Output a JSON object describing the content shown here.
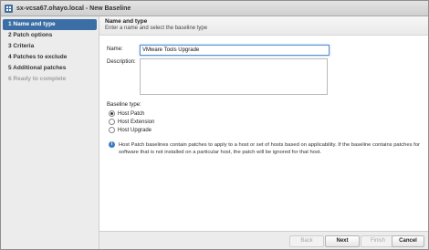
{
  "window": {
    "title": "sx-vcsa67.ohayo.local - New Baseline"
  },
  "sidebar": {
    "steps": [
      {
        "label": "1  Name and type"
      },
      {
        "label": "2  Patch options"
      },
      {
        "label": "3  Criteria"
      },
      {
        "label": "4  Patches to exclude"
      },
      {
        "label": "5  Additional patches"
      },
      {
        "label": "6  Ready to complete"
      }
    ]
  },
  "header": {
    "title": "Name and type",
    "subtitle": "Enter a name and select the baseline type"
  },
  "form": {
    "name_label": "Name:",
    "name_value": "VMware Tools Upgrade",
    "description_label": "Description:",
    "description_value": "",
    "baseline_type_label": "Baseline type:",
    "options": [
      {
        "label": "Host Patch",
        "checked": true
      },
      {
        "label": "Host Extension",
        "checked": false
      },
      {
        "label": "Host Upgrade",
        "checked": false
      }
    ]
  },
  "info": {
    "icon": "info-icon",
    "text": "Host Patch baselines contain patches to apply to a host or set of hosts based on applicability. If the baseline contains patches for software that is not installed on a particular host, the patch will be ignored for that host."
  },
  "footer": {
    "back_label": "Back",
    "next_label": "Next",
    "finish_label": "Finish",
    "cancel_label": "Cancel"
  }
}
